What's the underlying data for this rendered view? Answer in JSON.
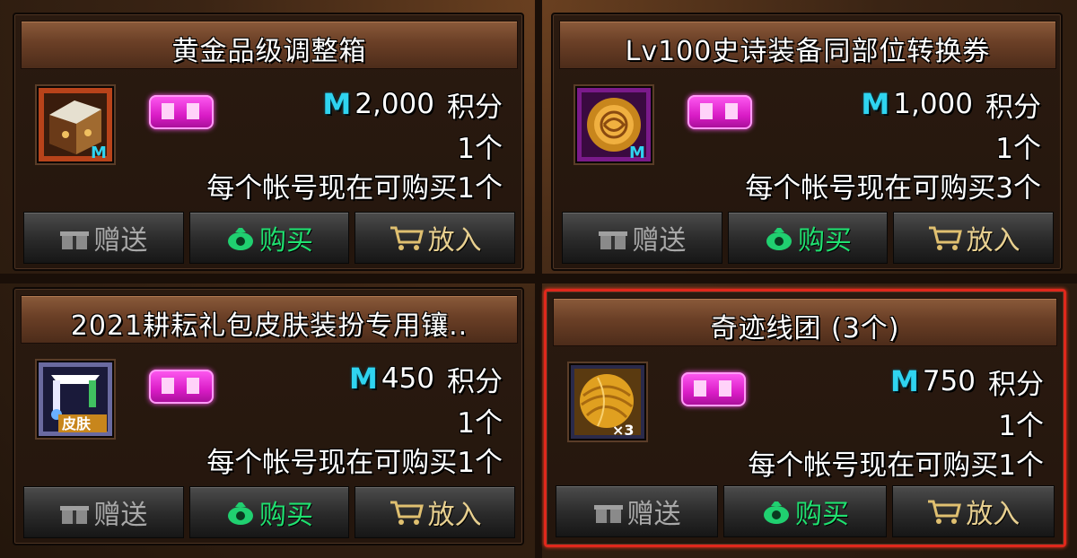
{
  "currency_icon": "M",
  "price_unit": "积分",
  "buttons": {
    "gift": "赠送",
    "buy": "购买",
    "cart": "放入"
  },
  "items": [
    {
      "name": "黄金品级调整箱",
      "price": "2,000",
      "quantity": "1个",
      "limit": "每个帐号现在可购买1个",
      "icon": "gold-grade-box-icon",
      "badge_icon": "limited-badge-icon"
    },
    {
      "name": "Lv100史诗装备同部位转换券",
      "price": "1,000",
      "quantity": "1个",
      "limit": "每个帐号现在可购买3个",
      "icon": "epic-conversion-ticket-icon",
      "badge_icon": "limited-badge-icon"
    },
    {
      "name": "2021耕耘礼包皮肤装扮专用镶..",
      "price": "450",
      "quantity": "1个",
      "limit": "每个帐号现在可购买1个",
      "icon": "skin-socket-icon",
      "icon_label": "皮肤",
      "badge_icon": "limited-badge-icon"
    },
    {
      "name": "奇迹线团 (3个)",
      "price": "750",
      "quantity": "1个",
      "limit": "每个帐号现在可购买1个",
      "icon": "miracle-yarn-ball-icon",
      "icon_label": "×3",
      "badge_icon": "limited-badge-icon",
      "selected": true
    }
  ],
  "colors": {
    "selection_border": "#e0281c",
    "currency": "#2fd4f0",
    "buy_text": "#20e070",
    "badge": "#e21bd0"
  }
}
